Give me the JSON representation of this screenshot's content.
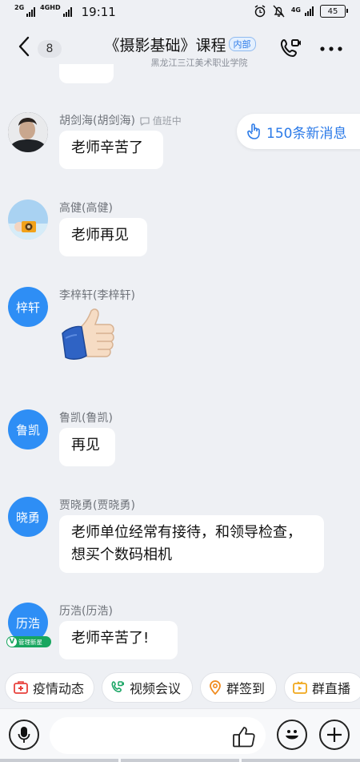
{
  "status": {
    "net1": "2G",
    "net2": "4GHD",
    "time": "19:11",
    "net3": "4G",
    "battery": "45"
  },
  "header": {
    "back_count": "8",
    "title": "《摄影基础》课程",
    "tag": "内部",
    "subtitle": "黑龙江三江美术职业学院"
  },
  "new_messages": "150条新消息",
  "messages": [
    {
      "sender": "胡剑海(胡剑海)",
      "status": "值班中",
      "text": "老师辛苦了",
      "avatar": "photo-person"
    },
    {
      "sender": "高健(高健)",
      "text": "老师再见",
      "avatar": "photo-camera"
    },
    {
      "sender": "李梓轩(李梓轩)",
      "avatar_text": "梓轩",
      "sticker": "thumbs-up"
    },
    {
      "sender": "鲁凯(鲁凯)",
      "avatar_text": "鲁凯",
      "text": "再见"
    },
    {
      "sender": "贾晓勇(贾晓勇)",
      "avatar_text": "晓勇",
      "text": "老师单位经常有接待，和领导检查，想买个数码相机"
    },
    {
      "sender": "历浩(历浩)",
      "avatar_text": "历浩",
      "text": "老师辛苦了!",
      "badge": "管理新星",
      "badge_icon": "V"
    }
  ],
  "quick_actions": [
    {
      "label": "疫情动态",
      "icon": "medkit-icon",
      "color": "#e8413c"
    },
    {
      "label": "视频会议",
      "icon": "phone-video-icon",
      "color": "#19a564"
    },
    {
      "label": "群签到",
      "icon": "location-icon",
      "color": "#f08a1c"
    },
    {
      "label": "群直播",
      "icon": "tv-icon",
      "color": "#f0a81c"
    }
  ],
  "input": {
    "placeholder": ""
  },
  "colors": {
    "accent": "#2e8ef5",
    "background": "#eef0f4"
  }
}
